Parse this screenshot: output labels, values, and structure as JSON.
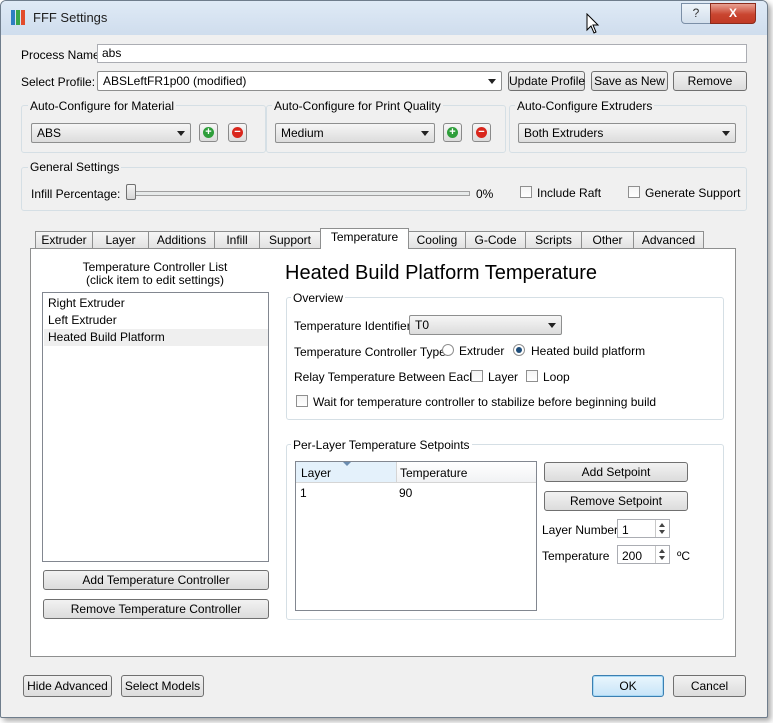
{
  "window": {
    "title": "FFF Settings",
    "help_label": "?",
    "close_label": "X"
  },
  "process": {
    "label": "Process Name:",
    "value": "abs"
  },
  "profile": {
    "label": "Select Profile:",
    "value": "ABSLeftFR1p00 (modified)",
    "update": "Update Profile",
    "save_as_new": "Save as New",
    "remove": "Remove"
  },
  "auto_material": {
    "title": "Auto-Configure for Material",
    "value": "ABS"
  },
  "auto_quality": {
    "title": "Auto-Configure for Print Quality",
    "value": "Medium"
  },
  "auto_extruders": {
    "title": "Auto-Configure Extruders",
    "value": "Both Extruders"
  },
  "general": {
    "title": "General Settings",
    "infill_label": "Infill Percentage:",
    "infill_value": "0%",
    "infill_fraction": 0,
    "include_raft": "Include Raft",
    "generate_support": "Generate Support"
  },
  "tabs": [
    "Extruder",
    "Layer",
    "Additions",
    "Infill",
    "Support",
    "Temperature",
    "Cooling",
    "G-Code",
    "Scripts",
    "Other",
    "Advanced"
  ],
  "temperature": {
    "list_title_line1": "Temperature Controller List",
    "list_title_line2": "(click item to edit settings)",
    "controllers": [
      "Right Extruder",
      "Left Extruder",
      "Heated Build Platform"
    ],
    "add_button": "Add Temperature Controller",
    "remove_button": "Remove Temperature Controller",
    "heading": "Heated Build Platform Temperature",
    "overview": {
      "title": "Overview",
      "identifier_label": "Temperature Identifier",
      "identifier_value": "T0",
      "type_label": "Temperature Controller Type:",
      "type_extruder": "Extruder",
      "type_platform": "Heated build platform",
      "relay_label": "Relay Temperature Between Each:",
      "relay_layer": "Layer",
      "relay_loop": "Loop",
      "wait_label": "Wait for temperature controller to stabilize before beginning build"
    },
    "setpoints": {
      "title": "Per-Layer Temperature Setpoints",
      "columns": [
        "Layer",
        "Temperature"
      ],
      "rows": [
        [
          "1",
          "90"
        ]
      ],
      "add": "Add Setpoint",
      "remove": "Remove Setpoint",
      "layer_number_label": "Layer Number",
      "layer_number_value": "1",
      "temperature_label": "Temperature",
      "temperature_value": "200",
      "unit": "ºC"
    }
  },
  "footer": {
    "hide_advanced": "Hide Advanced",
    "select_models": "Select Models",
    "ok": "OK",
    "cancel": "Cancel"
  }
}
